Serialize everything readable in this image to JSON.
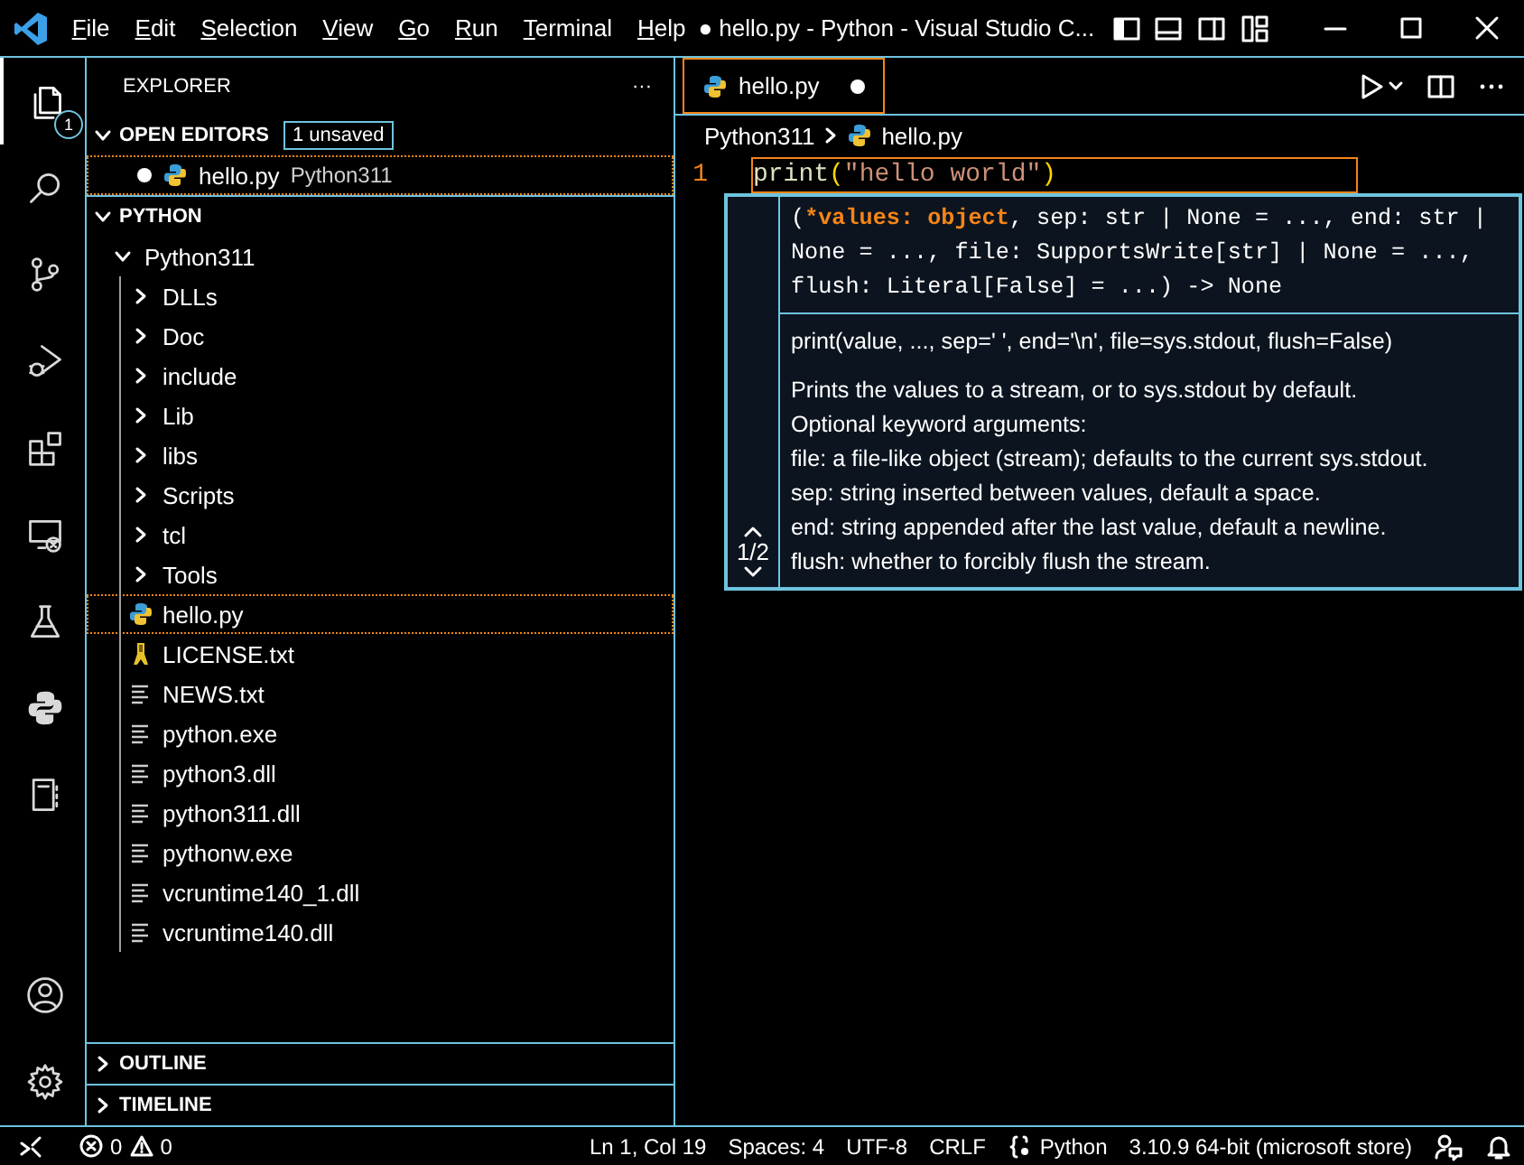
{
  "title_bar": {
    "menus": [
      "File",
      "Edit",
      "Selection",
      "View",
      "Go",
      "Run",
      "Terminal",
      "Help"
    ],
    "title": "● hello.py - Python - Visual Studio C..."
  },
  "activity_bar": {
    "top": [
      {
        "kind": "explorer",
        "selected": true,
        "badge": "1"
      },
      {
        "kind": "search",
        "selected": false
      },
      {
        "kind": "source-control",
        "selected": false
      },
      {
        "kind": "run-debug",
        "selected": false
      },
      {
        "kind": "extensions",
        "selected": false
      },
      {
        "kind": "remote-explorer",
        "selected": false
      },
      {
        "kind": "testing",
        "selected": false
      },
      {
        "kind": "python",
        "selected": false
      },
      {
        "kind": "notebook",
        "selected": false
      }
    ],
    "bottom": [
      {
        "kind": "accounts",
        "selected": false
      },
      {
        "kind": "settings",
        "selected": false
      }
    ]
  },
  "explorer": {
    "title": "EXPLORER",
    "more": "···",
    "open_editors": {
      "label": "OPEN EDITORS",
      "expanded": true,
      "badge": "1 unsaved",
      "items": [
        {
          "name": "hello.py",
          "description": "Python311",
          "dirty": true,
          "selected": true
        }
      ]
    },
    "folder": {
      "label": "PYTHON",
      "expanded": true,
      "tree": [
        {
          "name": "Python311",
          "kind": "folder",
          "expanded": true,
          "selected": false,
          "children": [
            {
              "name": "DLLs",
              "kind": "folder",
              "expanded": false,
              "selected": false
            },
            {
              "name": "Doc",
              "kind": "folder",
              "expanded": false,
              "selected": false
            },
            {
              "name": "include",
              "kind": "folder",
              "expanded": false,
              "selected": false
            },
            {
              "name": "Lib",
              "kind": "folder",
              "expanded": false,
              "selected": false
            },
            {
              "name": "libs",
              "kind": "folder",
              "expanded": false,
              "selected": false
            },
            {
              "name": "Scripts",
              "kind": "folder",
              "expanded": false,
              "selected": false
            },
            {
              "name": "tcl",
              "kind": "folder",
              "expanded": false,
              "selected": false
            },
            {
              "name": "Tools",
              "kind": "folder",
              "expanded": false,
              "selected": false
            },
            {
              "name": "hello.py",
              "kind": "python",
              "selected": true
            },
            {
              "name": "LICENSE.txt",
              "kind": "license",
              "selected": false
            },
            {
              "name": "NEWS.txt",
              "kind": "text",
              "selected": false
            },
            {
              "name": "python.exe",
              "kind": "text",
              "selected": false
            },
            {
              "name": "python3.dll",
              "kind": "text",
              "selected": false
            },
            {
              "name": "python311.dll",
              "kind": "text",
              "selected": false
            },
            {
              "name": "pythonw.exe",
              "kind": "text",
              "selected": false
            },
            {
              "name": "vcruntime140_1.dll",
              "kind": "text",
              "selected": false
            },
            {
              "name": "vcruntime140.dll",
              "kind": "text",
              "selected": false
            }
          ]
        }
      ]
    },
    "collapsed_sections": [
      {
        "label": "OUTLINE",
        "expanded": false
      },
      {
        "label": "TIMELINE",
        "expanded": false
      }
    ]
  },
  "editor": {
    "tabs": [
      {
        "label": "hello.py",
        "dirty": true,
        "selected": true
      }
    ],
    "breadcrumbs": [
      "Python311",
      "hello.py"
    ],
    "lines": [
      {
        "number": "1",
        "active": true,
        "tokens": [
          {
            "text": "print",
            "kind": "function"
          },
          {
            "text": "(",
            "kind": "bracket"
          },
          {
            "text": "\"hello world\"",
            "kind": "string"
          },
          {
            "text": ")",
            "kind": "bracket"
          }
        ]
      }
    ],
    "signature_help": {
      "before": "(",
      "active_parameter": "*values: object",
      "after": ", sep: str | None = ..., end: str | None = ..., file: SupportsWrite[str] | None = ..., flush: Literal[False] = ...) -> None",
      "counter": "1/2",
      "usage": "print(value, ..., sep=' ', end='\\n', file=sys.stdout, flush=False)",
      "doc_lines": [
        "Prints the values to a stream, or to sys.stdout by default.",
        "Optional keyword arguments:",
        "file: a file-like object (stream); defaults to the current sys.stdout.",
        "sep: string inserted between values, default a space.",
        "end: string appended after the last value, default a newline.",
        "flush: whether to forcibly flush the stream."
      ]
    }
  },
  "status_bar": {
    "errors": "0",
    "warnings": "0",
    "right": [
      {
        "text": "Ln 1, Col 19",
        "kind": "text"
      },
      {
        "text": "Spaces: 4",
        "kind": "text"
      },
      {
        "text": "UTF-8",
        "kind": "text"
      },
      {
        "text": "CRLF",
        "kind": "text"
      },
      {
        "text": "Python",
        "kind": "language"
      },
      {
        "text": "3.10.9 64-bit (microsoft store)",
        "kind": "text"
      }
    ]
  }
}
